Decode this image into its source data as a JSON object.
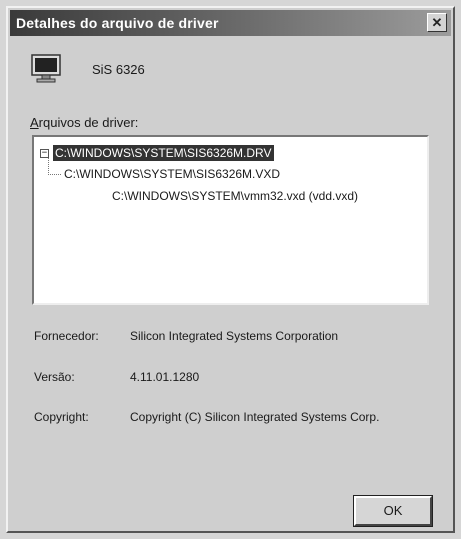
{
  "window": {
    "title": "Detalhes do arquivo de driver",
    "close_label": "✕"
  },
  "device": {
    "name": "SiS 6326",
    "icon": "monitor-icon"
  },
  "files": {
    "label_accel": "A",
    "label_rest": "rquivos de driver:",
    "tree": {
      "root": "C:\\WINDOWS\\SYSTEM\\SIS6326M.DRV",
      "root_expander": "−",
      "child": "C:\\WINDOWS\\SYSTEM\\SIS6326M.VXD",
      "leaf": "C:\\WINDOWS\\SYSTEM\\vmm32.vxd (vdd.vxd)"
    }
  },
  "details": {
    "provider_label": "Fornecedor:",
    "provider_value": "Silicon Integrated Systems Corporation",
    "version_label": "Versão:",
    "version_value": "4.11.01.1280",
    "copyright_label": "Copyright:",
    "copyright_value": "Copyright (C) Silicon Integrated Systems Corp."
  },
  "buttons": {
    "ok": "OK"
  }
}
